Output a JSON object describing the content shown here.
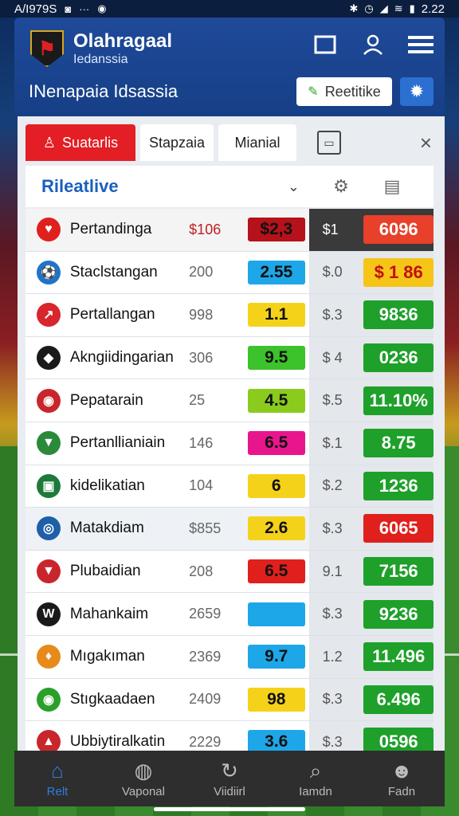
{
  "statusbar": {
    "left_text": "A/I979S",
    "time": "2.22"
  },
  "app": {
    "title": "Olahragaal",
    "subtitle": "Iedanssia"
  },
  "header": {
    "section_title": "INenapaia Idsassia",
    "action_label": "Reetitike"
  },
  "tabs": [
    {
      "label": "Suatarlis",
      "active": true
    },
    {
      "label": "Stapzaia",
      "active": false
    },
    {
      "label": "Mianial",
      "active": false
    }
  ],
  "filter": {
    "label": "Rileatlive"
  },
  "rows": [
    {
      "name": "Pertandinga",
      "n1": "$106",
      "odd1": "$2,3",
      "odd1_color": "#b5121b",
      "n2": "$1",
      "odd2": "6096",
      "odd2_color": "#e8402a",
      "logo_color": "#e0201c",
      "logo": "♥"
    },
    {
      "name": "Staclstangan",
      "n1": "200",
      "odd1": "2.55",
      "odd1_color": "#1ea7e8",
      "n2": "$.0",
      "odd2": "$ 1 86",
      "odd2_color": "#f5c518",
      "logo_color": "#1f73c9",
      "logo": "⚽"
    },
    {
      "name": "Pertallangan",
      "n1": "998",
      "odd1": "1.1",
      "odd1_color": "#f5d21a",
      "n2": "$.3",
      "odd2": "9836",
      "odd2_color": "#1ea02a",
      "logo_color": "#d8262c",
      "logo": "↗"
    },
    {
      "name": "Akngiidingarian",
      "n1": "306",
      "odd1": "9.5",
      "odd1_color": "#3cc22a",
      "n2": "$ 4",
      "odd2": "0236",
      "odd2_color": "#1ea02a",
      "logo_color": "#1a1a1a",
      "logo": "◆"
    },
    {
      "name": "Pepatarain",
      "n1": "25",
      "odd1": "4.5",
      "odd1_color": "#8acb1e",
      "n2": "$.5",
      "odd2": "11.10%",
      "odd2_color": "#1ea02a",
      "logo_color": "#c8262c",
      "logo": "◉"
    },
    {
      "name": "Pertanllianiain",
      "n1": "146",
      "odd1": "6.5",
      "odd1_color": "#e8168c",
      "n2": "$.1",
      "odd2": "8.75",
      "odd2_color": "#1ea02a",
      "logo_color": "#2a8a3a",
      "logo": "▼"
    },
    {
      "name": "kidelikatian",
      "n1": "104",
      "odd1": "6",
      "odd1_color": "#f5d21a",
      "n2": "$.2",
      "odd2": "1236",
      "odd2_color": "#1ea02a",
      "logo_color": "#1e7a3a",
      "logo": "▣"
    },
    {
      "name": "Matakdiam",
      "n1": "$855",
      "odd1": "2.6",
      "odd1_color": "#f5d21a",
      "n2": "$.3",
      "odd2": "6065",
      "odd2_color": "#e0201c",
      "logo_color": "#1f5fa8",
      "logo": "◎"
    },
    {
      "name": "Plubaidian",
      "n1": "208",
      "odd1": "6.5",
      "odd1_color": "#e0201c",
      "n2": "9.1",
      "odd2": "7156",
      "odd2_color": "#1ea02a",
      "logo_color": "#c8262c",
      "logo": "▼"
    },
    {
      "name": "Mahankaim",
      "n1": "2659",
      "odd1": "",
      "odd1_color": "#1ea7e8",
      "n2": "$.3",
      "odd2": "9236",
      "odd2_color": "#1ea02a",
      "logo_color": "#1a1a1a",
      "logo": "W"
    },
    {
      "name": "Mıgakıman",
      "n1": "2369",
      "odd1": "9.7",
      "odd1_color": "#1ea7e8",
      "n2": "1.2",
      "odd2": "11.496",
      "odd2_color": "#1ea02a",
      "logo_color": "#e88a1a",
      "logo": "♦"
    },
    {
      "name": "Stıgkaadaen",
      "n1": "2409",
      "odd1": "98",
      "odd1_color": "#f5d21a",
      "n2": "$.3",
      "odd2": "6.496",
      "odd2_color": "#1ea02a",
      "logo_color": "#2aa02a",
      "logo": "◉"
    },
    {
      "name": "Ubbiytiralkatin",
      "n1": "2229",
      "odd1": "3.6",
      "odd1_color": "#1ea7e8",
      "n2": "$.3",
      "odd2": "0596",
      "odd2_color": "#1ea02a",
      "logo_color": "#c8262c",
      "logo": "▲"
    }
  ],
  "bottomnav": [
    {
      "label": "Relt",
      "icon": "home-icon",
      "active": true
    },
    {
      "label": "Vaponal",
      "icon": "ball-icon",
      "active": false
    },
    {
      "label": "Viidiirl",
      "icon": "refresh-icon",
      "active": false
    },
    {
      "label": "Iamdn",
      "icon": "search-icon",
      "active": false
    },
    {
      "label": "Fadn",
      "icon": "profile-icon",
      "active": false
    }
  ]
}
